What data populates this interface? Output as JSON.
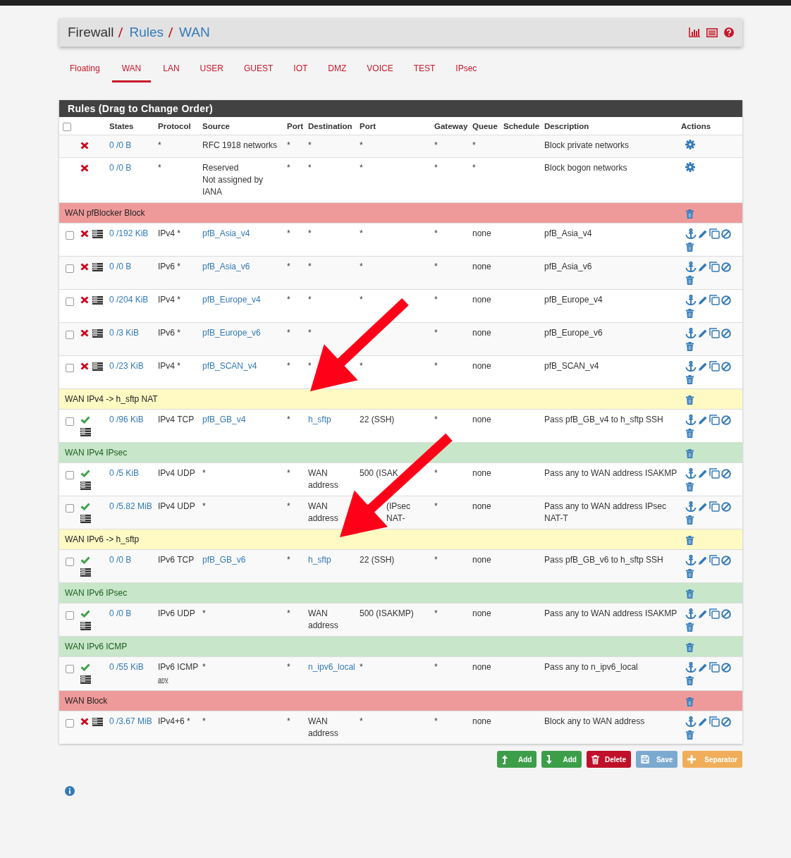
{
  "breadcrumb": [
    {
      "label": "Firewall",
      "link": false
    },
    {
      "label": "Rules",
      "link": true
    },
    {
      "label": "WAN",
      "link": true
    }
  ],
  "header_icons": [
    {
      "kind": "chart"
    },
    {
      "kind": "list"
    },
    {
      "kind": "help"
    }
  ],
  "tabs": [
    {
      "label": "Floating",
      "selected": false
    },
    {
      "label": "WAN",
      "selected": true
    },
    {
      "label": "LAN",
      "selected": false
    },
    {
      "label": "USER",
      "selected": false
    },
    {
      "label": "GUEST",
      "selected": false
    },
    {
      "label": "IOT",
      "selected": false
    },
    {
      "label": "DMZ",
      "selected": false
    },
    {
      "label": "VOICE",
      "selected": false
    },
    {
      "label": "TEST",
      "selected": false
    },
    {
      "label": "IPsec",
      "selected": false
    }
  ],
  "panel_title": "Rules (Drag to Change Order)",
  "select_all": {
    "checked": false
  },
  "columns": [
    "States",
    "Protocol",
    "Source",
    "Port",
    "Destination",
    "Port",
    "Gateway",
    "Queue",
    "Schedule",
    "Description",
    "Actions"
  ],
  "rows": [
    {
      "kind": "rule",
      "editable": false,
      "pass": false,
      "log": false,
      "states": "0 /0 B",
      "protocol": "*",
      "source": "RFC 1918 networks",
      "source_link": false,
      "source_port": "*",
      "destination": "*",
      "destination_link": false,
      "dest_port": "*",
      "gateway": "*",
      "queue": "*",
      "description": "Block private networks"
    },
    {
      "kind": "rule",
      "editable": false,
      "pass": false,
      "log": false,
      "states": "0 /0 B",
      "protocol": "*",
      "source": "Reserved",
      "source_note": "Not assigned by IANA",
      "source_link": false,
      "source_port": "*",
      "destination": "*",
      "destination_link": false,
      "dest_port": "*",
      "gateway": "*",
      "queue": "*",
      "description": "Block bogon networks"
    },
    {
      "kind": "separator",
      "label": "WAN pfBlocker Block",
      "color": "#ef9a9a"
    },
    {
      "kind": "rule",
      "editable": true,
      "checked": false,
      "pass": false,
      "log": true,
      "states": "0 /192 KiB",
      "protocol": "IPv4 *",
      "source": "pfB_Asia_v4",
      "source_link": true,
      "source_port": "*",
      "destination": "*",
      "destination_link": false,
      "dest_port": "*",
      "gateway": "*",
      "queue": "none",
      "description": "pfB_Asia_v4"
    },
    {
      "kind": "rule",
      "editable": true,
      "checked": false,
      "pass": false,
      "log": true,
      "states": "0 /0 B",
      "protocol": "IPv6 *",
      "source": "pfB_Asia_v6",
      "source_link": true,
      "source_port": "*",
      "destination": "*",
      "destination_link": false,
      "dest_port": "*",
      "gateway": "*",
      "queue": "none",
      "description": "pfB_Asia_v6"
    },
    {
      "kind": "rule",
      "editable": true,
      "checked": false,
      "pass": false,
      "log": true,
      "states": "0 /204 KiB",
      "protocol": "IPv4 *",
      "source": "pfB_Europe_v4",
      "source_link": true,
      "source_port": "*",
      "destination": "*",
      "destination_link": false,
      "dest_port": "*",
      "gateway": "*",
      "queue": "none",
      "description": "pfB_Europe_v4"
    },
    {
      "kind": "rule",
      "editable": true,
      "checked": false,
      "pass": false,
      "log": true,
      "states": "0 /3 KiB",
      "protocol": "IPv6 *",
      "source": "pfB_Europe_v6",
      "source_link": true,
      "source_port": "*",
      "destination": "*",
      "destination_link": false,
      "gateway": "*",
      "queue": "none",
      "description": "pfB_Europe_v6"
    },
    {
      "kind": "rule",
      "editable": true,
      "checked": false,
      "pass": false,
      "log": true,
      "states": "0 /23 KiB",
      "protocol": "IPv4 *",
      "source": "pfB_SCAN_v4",
      "source_link": true,
      "source_port": "*",
      "destination": "*",
      "destination_link": false,
      "dest_port": "*",
      "gateway": "*",
      "queue": "none",
      "description": "pfB_SCAN_v4"
    },
    {
      "kind": "separator",
      "label": "WAN IPv4 -> h_sftp NAT",
      "color": "#fff9c4"
    },
    {
      "kind": "rule",
      "editable": true,
      "checked": false,
      "pass": true,
      "log": true,
      "states": "0 /96 KiB",
      "protocol": "IPv4 TCP",
      "source": "pfB_GB_v4",
      "source_link": true,
      "source_port": "*",
      "destination": "h_sftp",
      "destination_link": true,
      "dest_port": "22 (SSH)",
      "gateway": "*",
      "queue": "none",
      "description": "Pass pfB_GB_v4 to h_sftp SSH"
    },
    {
      "kind": "separator",
      "label": "WAN IPv4 IPsec",
      "color": "#c8e6c9"
    },
    {
      "kind": "rule",
      "editable": true,
      "checked": false,
      "pass": true,
      "log": true,
      "states": "0 /5 KiB",
      "protocol": "IPv4 UDP",
      "source": "*",
      "source_link": false,
      "source_port": "*",
      "destination": "WAN address",
      "destination_link": false,
      "dest_port": "500 (ISAK",
      "gateway": "*",
      "queue": "none",
      "description": "Pass any to WAN address ISAKMP"
    },
    {
      "kind": "rule",
      "editable": true,
      "checked": false,
      "pass": true,
      "log": true,
      "states": "0 /5.82 MiB",
      "protocol": "IPv4 UDP",
      "source": "*",
      "source_link": false,
      "source_port": "*",
      "destination": "WAN address",
      "destination_link": false,
      "dest_port": "(IPsec NAT-",
      "dest_port_covered": true,
      "gateway": "*",
      "queue": "none",
      "description": "Pass any to WAN address IPsec NAT-T"
    },
    {
      "kind": "separator",
      "label": "WAN IPv6 -> h_sftp",
      "color": "#fff9c4"
    },
    {
      "kind": "rule",
      "editable": true,
      "checked": false,
      "pass": true,
      "log": true,
      "states": "0 /0 B",
      "protocol": "IPv6 TCP",
      "source": "pfB_GB_v6",
      "source_link": true,
      "source_port": "*",
      "destination": "h_sftp",
      "destination_link": true,
      "dest_port": "22 (SSH)",
      "gateway": "*",
      "queue": "none",
      "description": "Pass pfB_GB_v6 to h_sftp SSH"
    },
    {
      "kind": "separator",
      "label": "WAN IPv6 IPsec",
      "color": "#c8e6c9"
    },
    {
      "kind": "rule",
      "editable": true,
      "checked": false,
      "pass": true,
      "log": true,
      "states": "0 /0 B",
      "protocol": "IPv6 UDP",
      "source": "*",
      "source_link": false,
      "source_port": "*",
      "destination": "WAN address",
      "destination_link": false,
      "dest_port": "500 (ISAKMP)",
      "gateway": "*",
      "queue": "none",
      "description": "Pass any to WAN address ISAKMP"
    },
    {
      "kind": "separator",
      "label": "WAN IPv6 ICMP",
      "color": "#c8e6c9"
    },
    {
      "kind": "rule",
      "editable": true,
      "checked": false,
      "pass": true,
      "log": true,
      "states": "0 /55 KiB",
      "protocol": "IPv6 ICMP",
      "protocol_sub": "any",
      "source": "*",
      "source_link": false,
      "source_port": "*",
      "destination": "n_ipv6_local",
      "destination_link": true,
      "dest_port": "*",
      "gateway": "*",
      "queue": "none",
      "description": "Pass any to n_ipv6_local"
    },
    {
      "kind": "separator",
      "label": "WAN Block",
      "color": "#ef9a9a"
    },
    {
      "kind": "rule",
      "editable": true,
      "checked": false,
      "pass": false,
      "log": true,
      "states": "0 /3.67 MiB",
      "protocol": "IPv4+6 *",
      "source": "*",
      "source_link": false,
      "source_port": "*",
      "destination": "WAN address",
      "destination_link": false,
      "dest_port": "*",
      "gateway": "*",
      "queue": "none",
      "description": "Block any to WAN address"
    }
  ],
  "buttons": [
    {
      "kind": "add-top",
      "label": "Add"
    },
    {
      "kind": "add-bottom",
      "label": "Add"
    },
    {
      "kind": "delete",
      "label": "Delete"
    },
    {
      "kind": "save",
      "label": "Save"
    },
    {
      "kind": "separator",
      "label": "Separator"
    }
  ],
  "annotation_arrows": [
    {
      "kind": "arrow"
    },
    {
      "kind": "arrow"
    }
  ]
}
